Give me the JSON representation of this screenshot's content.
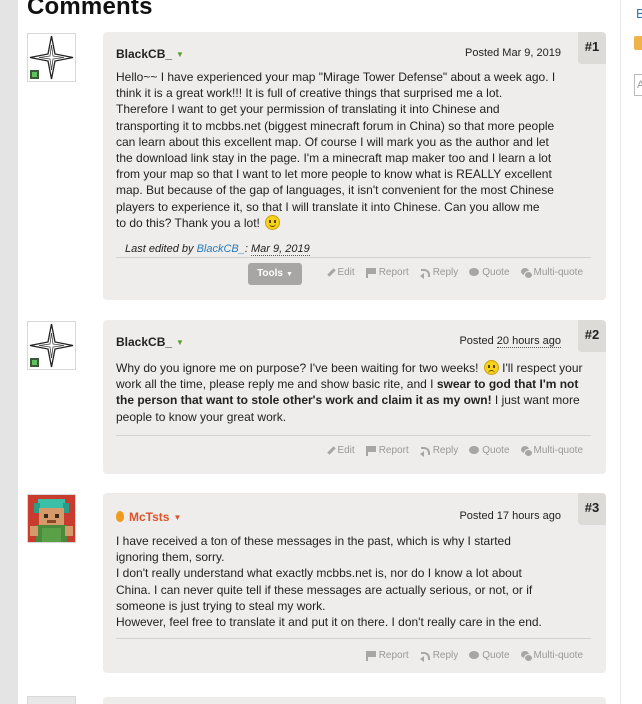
{
  "section_title": "Comments",
  "sidebar": {
    "link_text": "B",
    "input_placeholder": "A"
  },
  "posts": [
    {
      "number": "#1",
      "author": "BlackCB_",
      "posted_prefix": "Posted ",
      "posted_date": "Mar 9, 2019",
      "body_lines": [
        "Hello~~ I have experienced your map \"Mirage Tower Defense\" about a week ago. I",
        "think it is a great work!!! It is full of creative things that surprised me a lot.",
        "Therefore I want to get your permission of translating it into Chinese and",
        "transporting it to mcbbs.net (biggest minecraft forum in China) so that more people",
        "can learn about this excellent map. Of course I will mark you as the author and let",
        "the download link stay in the page. I'm a minecraft map maker too and I learn a lot",
        "from your map so that I want to let more people to know what is REALLY excellent",
        "map. But because of the gap of languages, it isn't convenient for the most Chinese",
        "players to experience it, so that I will translate it into Chinese. Can you allow me",
        "to do this? Thank you a lot!"
      ],
      "edited_prefix": "Last edited by ",
      "edited_user": "BlackCB_",
      "edited_sep": ": ",
      "edited_date": "Mar 9, 2019",
      "tools_label": "Tools",
      "actions": [
        "Edit",
        "Report",
        "Reply",
        "Quote",
        "Multi-quote"
      ]
    },
    {
      "number": "#2",
      "author": "BlackCB_",
      "posted_prefix": "Posted ",
      "posted_date": "20 hours ago",
      "body_a": "Why do you ignore me on purpose? I've been waiting for two weeks!",
      "body_b": " I'll respect your work all the time, please reply me and show basic rite, and I ",
      "body_bold": "swear to god that I'm not the person that want to stole other's work and claim it as my own!",
      "body_c": " I just want more people to know your great work.",
      "actions": [
        "Edit",
        "Report",
        "Reply",
        "Quote",
        "Multi-quote"
      ]
    },
    {
      "number": "#3",
      "author": "McTsts",
      "posted_prefix": "Posted ",
      "posted_date": "17 hours ago",
      "body_lines": [
        "I have received a ton of these messages in the past, which is why I started",
        "ignoring them, sorry.",
        "I don't really understand what exactly mcbbs.net is, nor do I know a lot about",
        "China. I can never quite tell if these messages are actually serious, or not, or if",
        "someone is just trying to steal my work.",
        "However, feel free to translate it and put it on there. I don't really care in the end."
      ],
      "actions": [
        "Report",
        "Reply",
        "Quote",
        "Multi-quote"
      ]
    }
  ],
  "colors": {
    "accent_link": "#2a7ab8",
    "author_alt": "#d9542b",
    "caret_green": "#5aa02c",
    "post_bg": "#efedeb"
  },
  "icons": [
    "compass-star-icon",
    "pixel-avatar-icon",
    "flame-icon",
    "smiley-icon",
    "sad-smiley-icon",
    "pencil-icon",
    "flag-icon",
    "reply-arrow-icon",
    "quote-bubble-icon",
    "multi-quote-icon"
  ]
}
